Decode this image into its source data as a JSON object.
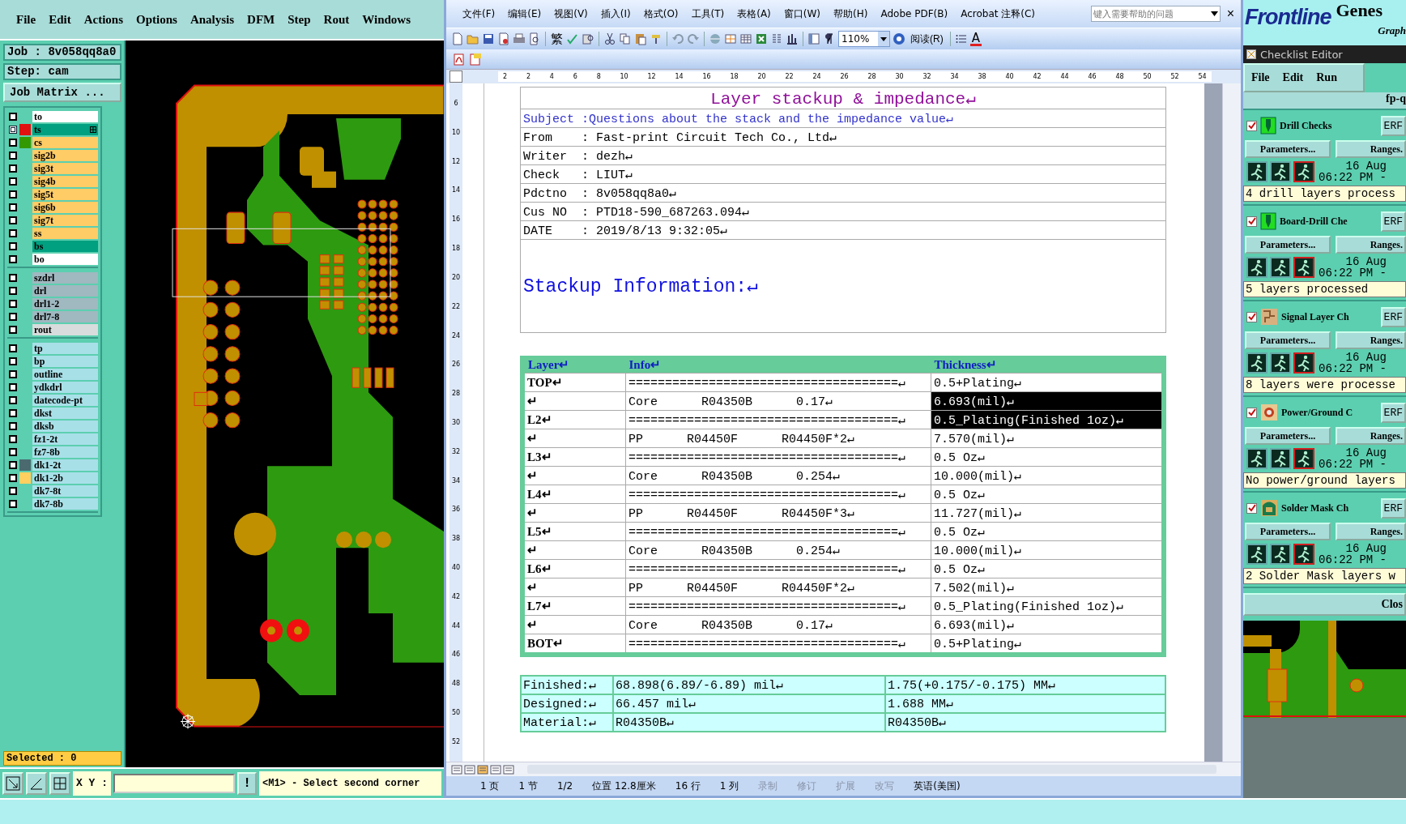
{
  "genesis": {
    "menu": [
      "File",
      "Edit",
      "Actions",
      "Options",
      "Analysis",
      "DFM",
      "Step",
      "Rout",
      "Windows"
    ],
    "job": "Job : 8v058qq8a0",
    "step": "Step: cam",
    "job_matrix_button": "Job Matrix ...",
    "layer_groups": [
      {
        "layers": [
          {
            "name": "to",
            "color": "#ffffff",
            "selected": false
          },
          {
            "name": "ts",
            "color": "#00a080",
            "swatch": {
              "color": "#e01010"
            },
            "selected": true
          },
          {
            "name": "cs",
            "color": "#ffcc66",
            "swatch": {
              "color": "#339900"
            },
            "selected": false
          },
          {
            "name": "sig2b",
            "color": "#ffcc66",
            "selected": false
          },
          {
            "name": "sig3t",
            "color": "#ffcc66",
            "selected": false
          },
          {
            "name": "sig4b",
            "color": "#ffcc66",
            "selected": false
          },
          {
            "name": "sig5t",
            "color": "#ffcc66",
            "selected": false
          },
          {
            "name": "sig6b",
            "color": "#ffcc66",
            "selected": false
          },
          {
            "name": "sig7t",
            "color": "#ffcc66",
            "selected": false
          },
          {
            "name": "ss",
            "color": "#ffcc66",
            "selected": false
          },
          {
            "name": "bs",
            "color": "#00a080",
            "selected": false
          },
          {
            "name": "bo",
            "color": "#ffffff",
            "selected": false
          }
        ]
      },
      {
        "layers": [
          {
            "name": "szdrl",
            "color": "#a0b8c0",
            "selected": false
          },
          {
            "name": "drl",
            "color": "#a0b8c0",
            "selected": false
          },
          {
            "name": "drl1-2",
            "color": "#a0b8c0",
            "selected": false
          },
          {
            "name": "drl7-8",
            "color": "#a0b8c0",
            "selected": false
          },
          {
            "name": "rout",
            "color": "#d8dcdc",
            "selected": false
          }
        ]
      },
      {
        "layers": [
          {
            "name": "tp",
            "color": "#a8e0e8",
            "selected": false
          },
          {
            "name": "bp",
            "color": "#a8e0e8",
            "selected": false
          },
          {
            "name": "outline",
            "color": "#a8e0e8",
            "selected": false
          },
          {
            "name": "ydkdrl",
            "color": "#a8e0e8",
            "selected": false
          },
          {
            "name": "datecode-pt",
            "color": "#a8e0e8",
            "selected": false
          },
          {
            "name": "dkst",
            "color": "#a8e0e8",
            "selected": false
          },
          {
            "name": "dksb",
            "color": "#a8e0e8",
            "selected": false
          },
          {
            "name": "fz1-2t",
            "color": "#a8e0e8",
            "selected": false
          },
          {
            "name": "fz7-8b",
            "color": "#a8e0e8",
            "selected": false
          },
          {
            "name": "dk1-2t",
            "color": "#a8e0e8",
            "swatch": {
              "color": "#4a6a70"
            },
            "selected": false
          },
          {
            "name": "dk1-2b",
            "color": "#a8e0e8",
            "swatch": {
              "color": "#ffd060"
            },
            "selected": false
          },
          {
            "name": "dk7-8t",
            "color": "#a8e0e8",
            "selected": false
          },
          {
            "name": "dk7-8b",
            "color": "#a8e0e8",
            "selected": false
          }
        ]
      }
    ],
    "selected_count": "Selected : 0",
    "xy_label": "X Y :",
    "alert_button": "!",
    "prompt": "<M1> - Select second corner"
  },
  "word": {
    "menu": [
      "文件(F)",
      "编辑(E)",
      "视图(V)",
      "插入(I)",
      "格式(O)",
      "工具(T)",
      "表格(A)",
      "窗口(W)",
      "帮助(H)",
      "Adobe PDF(B)",
      "Acrobat 注释(C)"
    ],
    "help_placeholder": "键入需要帮助的问题",
    "close": "×",
    "traditional_glyph": "繁",
    "zoom": "110%",
    "reading_button": "阅读(R)",
    "font_color_glyph": "A",
    "ruler_labels": [
      "2",
      "2",
      "4",
      "6",
      "8",
      "10",
      "12",
      "14",
      "16",
      "18",
      "20",
      "22",
      "24",
      "26",
      "28",
      "30",
      "32",
      "34",
      "38",
      "40",
      "42",
      "44",
      "46",
      "48",
      "50",
      "52",
      "54"
    ],
    "vruler_labels": [
      "6",
      "10",
      "12",
      "14",
      "16",
      "18",
      "20",
      "22",
      "24",
      "26",
      "28",
      "30",
      "32",
      "34",
      "36",
      "38",
      "40",
      "42",
      "44",
      "46",
      "48",
      "50",
      "52"
    ],
    "document": {
      "title": "Layer stackup & impedance↵",
      "subject": "Subject :Questions about the stack and the impedance value↵",
      "fields": [
        {
          "label": "From",
          "value": ": Fast-print Circuit Tech Co., Ltd↵"
        },
        {
          "label": "Writer",
          "value": ": dezh↵"
        },
        {
          "label": "Check",
          "value": ": LIUT↵"
        },
        {
          "label": "Pdctno",
          "value": ": 8v058qq8a0↵"
        },
        {
          "label": "Cus NO",
          "value": ": PTD18-590_687263.094↵"
        },
        {
          "label": "DATE",
          "value": ": 2019/8/13 9:32:05↵"
        }
      ],
      "section_heading": "Stackup Information:↵",
      "stack_columns": [
        "Layer↵",
        "Info↵",
        "Thickness↵"
      ],
      "stack_rows": [
        {
          "layer": "TOP↵",
          "info": "=====================================↵",
          "thickness": "0.5+Plating↵",
          "thickness_selected": false
        },
        {
          "layer": "↵",
          "info": "Core      R04350B      0.17↵",
          "thickness": "6.693(mil)↵",
          "thickness_selected": true
        },
        {
          "layer": "L2↵",
          "info": "=====================================↵",
          "thickness": "0.5_Plating(Finished 1oz)↵",
          "thickness_selected": true
        },
        {
          "layer": "↵",
          "info": "PP      R04450F      R04450F*2↵",
          "thickness": "7.570(mil)↵",
          "thickness_selected": false
        },
        {
          "layer": "L3↵",
          "info": "=====================================↵",
          "thickness": "0.5 Oz↵",
          "thickness_selected": false
        },
        {
          "layer": "↵",
          "info": "Core      R04350B      0.254↵",
          "thickness": "10.000(mil)↵",
          "thickness_selected": false
        },
        {
          "layer": "L4↵",
          "info": "=====================================↵",
          "thickness": "0.5 Oz↵",
          "thickness_selected": false
        },
        {
          "layer": "↵",
          "info": "PP      R04450F      R04450F*3↵",
          "thickness": "11.727(mil)↵",
          "thickness_selected": false
        },
        {
          "layer": "L5↵",
          "info": "=====================================↵",
          "thickness": "0.5 Oz↵",
          "thickness_selected": false
        },
        {
          "layer": "↵",
          "info": "Core      R04350B      0.254↵",
          "thickness": "10.000(mil)↵",
          "thickness_selected": false
        },
        {
          "layer": "L6↵",
          "info": "=====================================↵",
          "thickness": "0.5 Oz↵",
          "thickness_selected": false
        },
        {
          "layer": "↵",
          "info": "PP      R04450F      R04450F*2↵",
          "thickness": "7.502(mil)↵",
          "thickness_selected": false
        },
        {
          "layer": "L7↵",
          "info": "=====================================↵",
          "thickness": "0.5_Plating(Finished 1oz)↵",
          "thickness_selected": false
        },
        {
          "layer": "↵",
          "info": "Core      R04350B      0.17↵",
          "thickness": "6.693(mil)↵",
          "thickness_selected": false
        },
        {
          "layer": "BOT↵",
          "info": "=====================================↵",
          "thickness": "0.5+Plating↵",
          "thickness_selected": false
        }
      ],
      "summary_rows": [
        {
          "label": "Finished:↵",
          "mil": "68.898(6.89/-6.89) mil↵",
          "mm": "1.75(+0.175/-0.175) MM↵"
        },
        {
          "label": "Designed:↵",
          "mil": "66.457 mil↵",
          "mm": "1.688 MM↵"
        },
        {
          "label": "Material:↵",
          "mil": "R04350B↵",
          "mm": "R04350B↵"
        }
      ]
    },
    "status": [
      {
        "text": "1 页",
        "disabled": false
      },
      {
        "text": "1 节",
        "disabled": false
      },
      {
        "text": "1/2",
        "disabled": false
      },
      {
        "text": "位置 12.8厘米",
        "disabled": false
      },
      {
        "text": "16 行",
        "disabled": false
      },
      {
        "text": "1 列",
        "disabled": false
      },
      {
        "text": "录制",
        "disabled": true
      },
      {
        "text": "修订",
        "disabled": true
      },
      {
        "text": "扩展",
        "disabled": true
      },
      {
        "text": "改写",
        "disabled": true
      },
      {
        "text": "英语(美国)",
        "disabled": false
      }
    ]
  },
  "checklist": {
    "logo": "Frontline",
    "product": "Genes",
    "subtitle": "Graph",
    "window_title": "Checklist Editor",
    "menu": [
      "File",
      "Edit",
      "Run"
    ],
    "name": "fp-q",
    "checks": [
      {
        "kind": "drill",
        "name": "Drill Checks",
        "checked": true,
        "erf": "ERF",
        "parameters": "Parameters...",
        "ranges": "Ranges.",
        "date": "16 Aug",
        "time": "06:22 PM -",
        "message": "4 drill layers process"
      },
      {
        "kind": "drill",
        "name": "Board-Drill Che",
        "checked": true,
        "erf": "ERF",
        "parameters": "Parameters...",
        "ranges": "Ranges.",
        "date": "16 Aug",
        "time": "06:22 PM -",
        "message": "5 layers processed"
      },
      {
        "kind": "signal",
        "name": "Signal Layer Ch",
        "checked": true,
        "erf": "ERF",
        "parameters": "Parameters...",
        "ranges": "Ranges.",
        "date": "16 Aug",
        "time": "06:22 PM -",
        "message": "8 layers were processe"
      },
      {
        "kind": "power",
        "name": "Power/Ground C",
        "checked": true,
        "erf": "ERF",
        "parameters": "Parameters...",
        "ranges": "Ranges.",
        "date": "16 Aug",
        "time": "06:22 PM -",
        "message": "No power/ground layers"
      },
      {
        "kind": "solder",
        "name": "Solder Mask Ch",
        "checked": true,
        "erf": "ERF",
        "parameters": "Parameters...",
        "ranges": "Ranges.",
        "date": "16 Aug",
        "time": "06:22 PM -",
        "message": "2 Solder Mask layers w"
      }
    ],
    "close_button": "Clos"
  }
}
